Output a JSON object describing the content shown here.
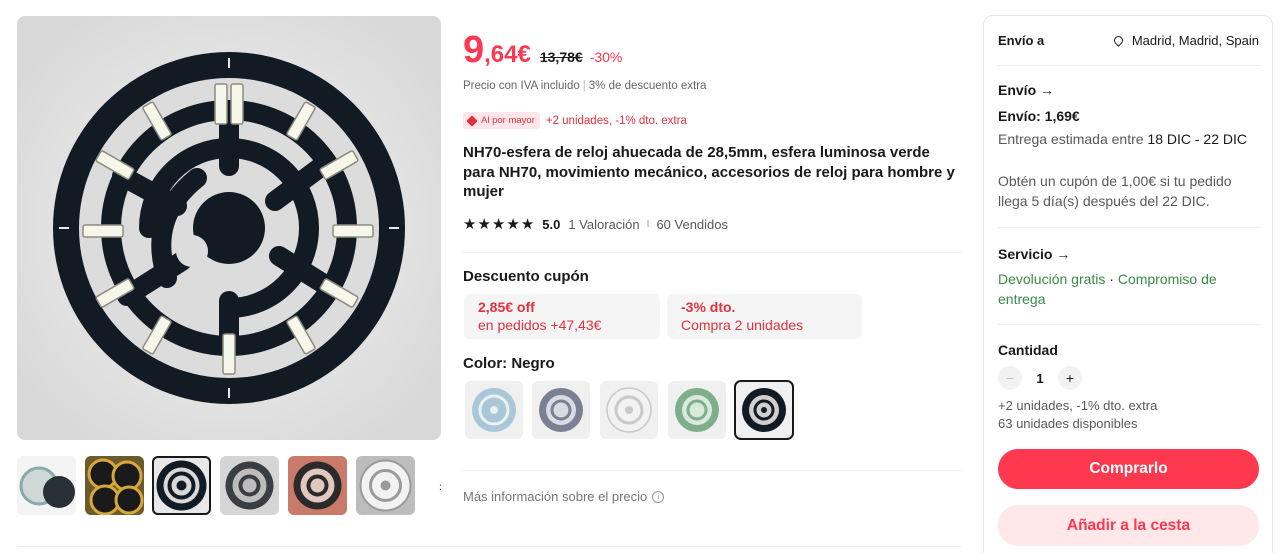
{
  "gallery": {
    "main_image_alt": "black watch dial",
    "thumbnails": [
      "thumb-1",
      "thumb-2",
      "thumb-3",
      "thumb-4",
      "thumb-5",
      "thumb-6"
    ],
    "next_icon": "chevron-right-icon"
  },
  "price": {
    "integer": "9",
    "decimal": ",64€",
    "old": "13,78€",
    "discount": "-30%",
    "tax_note": "Precio con IVA incluido",
    "tax_sep": "|",
    "extra_discount": "3% de descuento extra"
  },
  "wholesale": {
    "badge": "Al por mayor",
    "text": "+2 unidades, -1% dto. extra"
  },
  "product": {
    "title": "NH70-esfera de reloj ahuecada de 28,5mm, esfera luminosa verde para NH70, movimiento mecánico, accesorios de reloj para hombre y mujer"
  },
  "rating": {
    "stars": 5,
    "score": "5.0",
    "reviews": "1 Valoración",
    "sep": "I",
    "sold": "60 Vendidos"
  },
  "coupons": {
    "heading": "Descuento cupón",
    "items": [
      {
        "big": "2,85€ off",
        "small": "en pedidos +47,43€"
      },
      {
        "big": "-3% dto.",
        "small": "Compra 2 unidades"
      }
    ]
  },
  "color": {
    "heading": "Color: Negro",
    "selected_index": 4
  },
  "more_info": "Más información sobre el precio",
  "shipping_panel": {
    "ship_to_label": "Envío a",
    "location": "Madrid, Madrid, Spain",
    "shipping_heading": "Envío →",
    "shipping_cost": "Envío: 1,69€",
    "delivery_prefix": "Entrega estimada entre ",
    "delivery_dates": "18 DIC - 22 DIC",
    "coupon_note": "Obtén un cupón de 1,00€ si tu pedido llega 5 día(s) después del 22 DIC.",
    "service_heading": "Servicio →",
    "service_return": "Devolución gratis",
    "service_dot": " · ",
    "service_commitment": "Compromiso de entrega",
    "quantity_heading": "Cantidad",
    "quantity_value": "1",
    "quantity_minus": "−",
    "quantity_plus": "+",
    "bulk_note": "+2 unidades, -1% dto. extra",
    "stock_note": "63 unidades disponibles",
    "buy_label": "Comprarlo",
    "cart_label": "Añadir a la cesta"
  },
  "colors": {
    "accent": "#fd384f",
    "accent_soft": "#ffe7ea",
    "green": "#3a8a4a"
  }
}
